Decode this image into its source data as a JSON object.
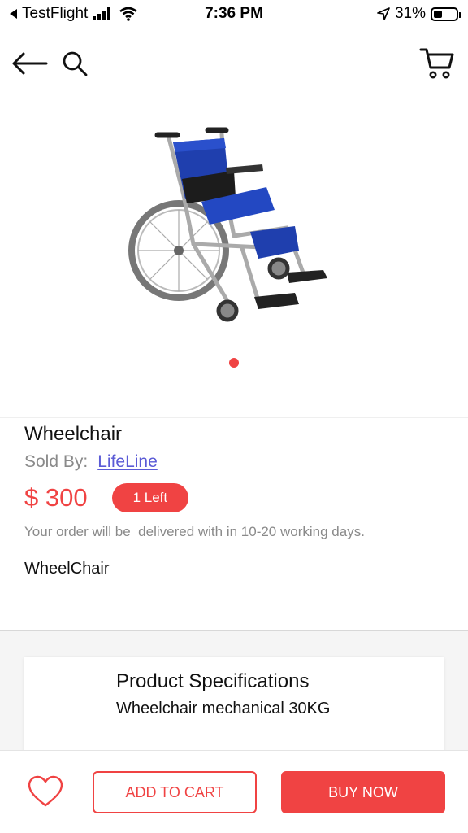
{
  "status_bar": {
    "back_app": "TestFlight",
    "time": "7:36 PM",
    "battery": "31%"
  },
  "header": {
    "back_icon": "arrow-left-icon",
    "search_icon": "search-icon",
    "cart_icon": "cart-icon"
  },
  "product": {
    "image_icon": "wheelchair-image",
    "carousel_page": 1,
    "carousel_total": 1,
    "title": "Wheelchair",
    "sold_by_label": "Sold By:",
    "seller": "LifeLine",
    "price": "$ 300",
    "stock_badge": "1 Left",
    "delivery_note": "Your order will be  delivered with in 10-20 working days.",
    "description": "WheelChair"
  },
  "specifications": {
    "title": "Product Specifications",
    "value": "Wheelchair mechanical 30KG"
  },
  "actions": {
    "favorite_icon": "heart-icon",
    "add_to_cart": "ADD TO CART",
    "buy_now": "BUY NOW"
  },
  "colors": {
    "accent": "#f04343",
    "link": "#5b5bd6",
    "muted_text": "#8a8a8a"
  }
}
